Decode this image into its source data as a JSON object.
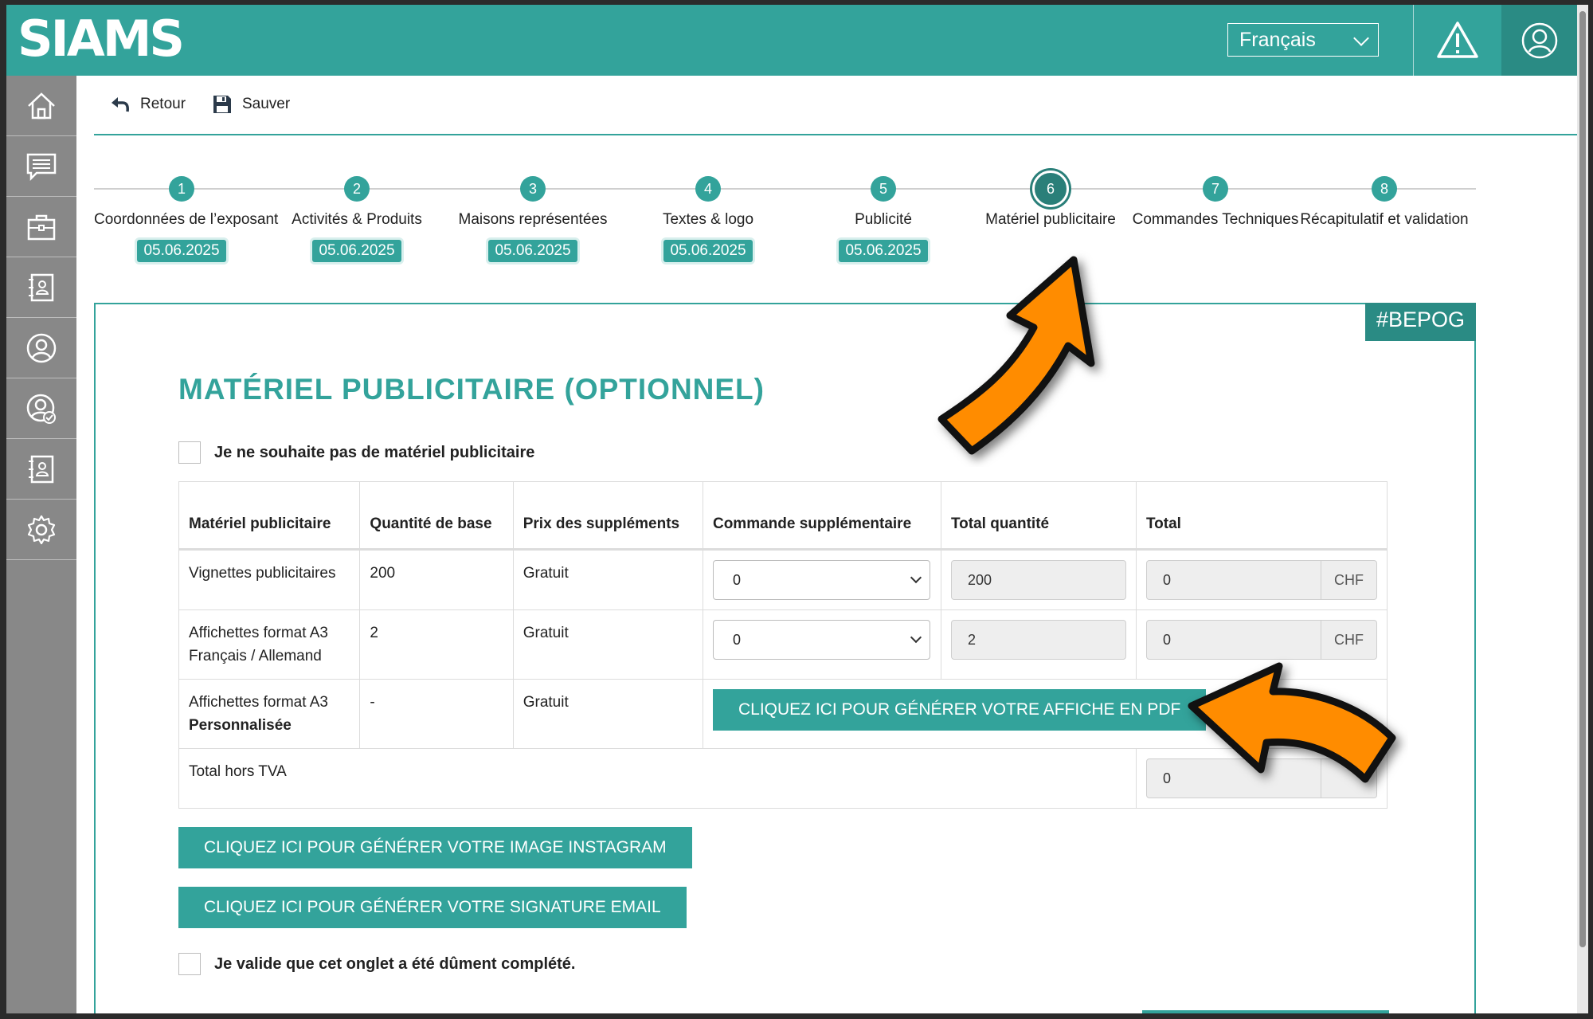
{
  "header": {
    "logo": "SIAMS",
    "language": "Français",
    "warning_icon": "warning-icon",
    "user_icon": "user-icon"
  },
  "sidebar": {
    "items": [
      {
        "icon": "home-icon"
      },
      {
        "icon": "messages-icon"
      },
      {
        "icon": "briefcase-icon"
      },
      {
        "icon": "contact-book-icon"
      },
      {
        "icon": "user-circle-icon"
      },
      {
        "icon": "user-check-icon"
      },
      {
        "icon": "contact-card-icon"
      },
      {
        "icon": "gear-icon"
      }
    ]
  },
  "toolbar": {
    "back_label": "Retour",
    "save_label": "Sauver"
  },
  "stepper": {
    "steps": [
      {
        "num": "1",
        "label": "Coordonnées de l’exposant",
        "date": "05.06.2025"
      },
      {
        "num": "2",
        "label": "Activités & Produits",
        "date": "05.06.2025"
      },
      {
        "num": "3",
        "label": "Maisons représentées",
        "date": "05.06.2025"
      },
      {
        "num": "4",
        "label": "Textes & logo",
        "date": "05.06.2025"
      },
      {
        "num": "5",
        "label": "Publicité",
        "date": "05.06.2025"
      },
      {
        "num": "6",
        "label": "Matériel publicitaire",
        "date": ""
      },
      {
        "num": "7",
        "label": "Commandes Techniques",
        "date": ""
      },
      {
        "num": "8",
        "label": "Récapitulatif et validation",
        "date": ""
      }
    ],
    "active_step": 6
  },
  "panel": {
    "tag": "#BEPOG",
    "title": "MATÉRIEL PUBLICITAIRE (OPTIONNEL)",
    "opt_out_label": "Je ne souhaite pas de matériel publicitaire",
    "table": {
      "headers": [
        "Matériel publicitaire",
        "Quantité de base",
        "Prix des suppléments",
        "Commande supplémentaire",
        "Total quantité",
        "Total"
      ],
      "rows": [
        {
          "name": "Vignettes publicitaires",
          "base": "200",
          "price": "Gratuit",
          "order": "0",
          "total_qty": "200",
          "total": "0",
          "currency": "CHF"
        },
        {
          "name": "Affichettes format A3 Français / Allemand",
          "base": "2",
          "price": "Gratuit",
          "order": "0",
          "total_qty": "2",
          "total": "0",
          "currency": "CHF"
        },
        {
          "name_line1": "Affichettes format A3",
          "name_line2": "Personnalisée",
          "base": "-",
          "price": "Gratuit",
          "button": "CLIQUEZ ICI POUR GÉNÉRER VOTRE AFFICHE EN PDF"
        }
      ],
      "total_label": "Total hors TVA",
      "total_value": "0"
    },
    "instagram_button": "CLIQUEZ ICI POUR GÉNÉRER VOTRE IMAGE INSTAGRAM",
    "email_button": "CLIQUEZ ICI POUR GÉNÉRER VOTRE SIGNATURE EMAIL",
    "validate_label": "Je valide que cet onglet a été dûment complété."
  },
  "colors": {
    "accent": "#33a39b",
    "accent_dark": "#2a8b84",
    "sidebar": "#888888",
    "annotation_arrow": "#ff8c00"
  }
}
